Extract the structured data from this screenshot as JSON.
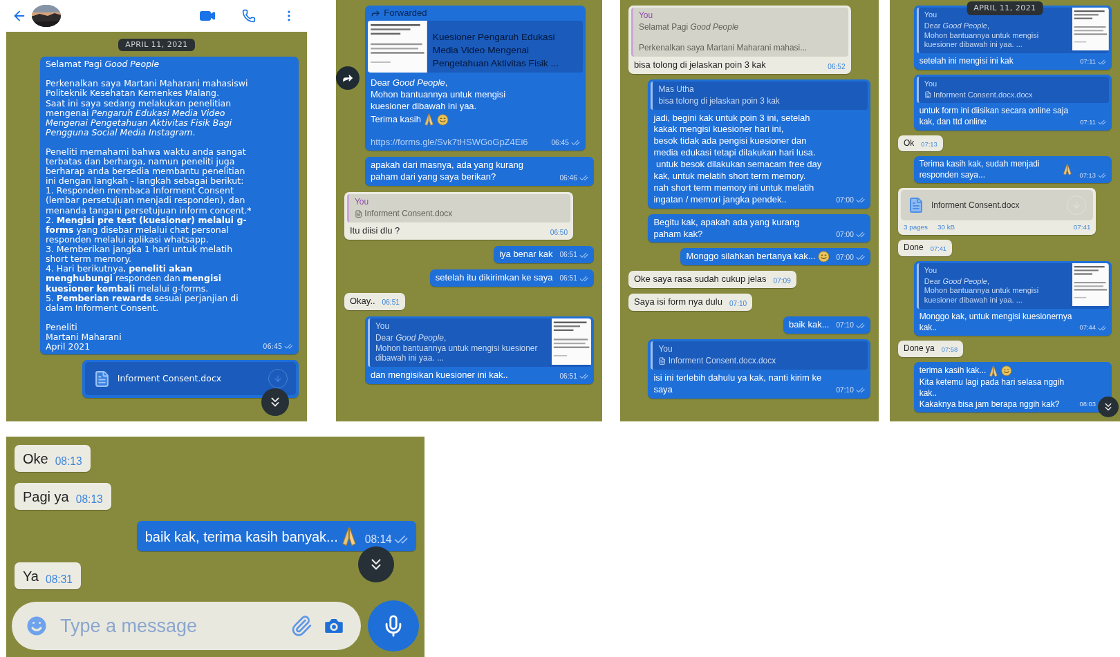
{
  "screens": [
    {
      "header": {
        "avatar": {
          "kind": "picture"
        }
      },
      "scroll_button": true,
      "messages": [
        {
          "kind": "date",
          "text": "APRIL 11, 2021"
        },
        {
          "kind": "text",
          "outgoing": true,
          "paragraphs": [
            [
              "Selamat Pagi *Good People*"
            ],
            [
              "Perkenalkan saya Martani Maharani mahasiswi Politeknik Kesehatan Kemenkes Malang.",
              "Saat ini saya sedang melakukan penelitian mengenai *Pengaruh Edukasi Media Video Mengenai Pengetahuan Aktivitas Fisik Bagi Pengguna Social Media Instagram*."
            ],
            [
              "Peneliti memahami bahwa waktu anda sangat terbatas dan berharga, namun peneliti juga berharap anda bersedia membantu penelitian ini dengan langkah - langkah sebagai berikut:",
              "1. Responden membaca Informent Consent (lembar persetujuan menjadi responden), dan menanda tangani persetujuan inform concent.*",
              "2. **Mengisi pre test (kuesioner) melalui g-forms** yang disebar melalui chat personal responden melalui aplikasi whatsapp.",
              "3. Memberikan jangka 1 hari untuk melatih short term memory.",
              "4. Hari berikutnya, **peneliti akan menghubungi** responden dan **mengisi kuesioner kembali** melalui g-forms.",
              "5. **Pemberian rewards** sesuai perjanjian di dalam Informent Consent."
            ],
            [
              "Peneliti",
              "Martani Maharani",
              "April 2021"
            ]
          ],
          "time": "06:45"
        },
        {
          "kind": "document",
          "outgoing": true,
          "file": "Informent Consent.docx"
        }
      ]
    },
    {
      "messages": [
        {
          "kind": "text",
          "outgoing": true,
          "forwarded": "Forwarded",
          "forward_button": true,
          "preview": {
            "thumbnail": true,
            "title": "Kuesioner Pengaruh Edukasi Media Video Mengenai Pengetahuan Aktivitas Fisik ..."
          },
          "lines": [
            {
              "text": "Dear *Good People*,"
            },
            {
              "text": "Mohon bantuannya untuk mengisi kuesioner dibawah ini yaa."
            },
            {
              "text": "Terima kasih",
              "emoji": [
                {
                  "kind": "pray"
                },
                {
                  "kind": "smile"
                }
              ]
            }
          ],
          "link": "https://forms.gle/Svk7tHSWGoGpZ4Ei6",
          "time": "06:45"
        },
        {
          "kind": "text",
          "outgoing": true,
          "lines": [
            {
              "text": "apakah dari masnya, ada yang kurang paham dari yang saya berikan?"
            }
          ],
          "time": "06:46"
        },
        {
          "kind": "text",
          "outgoing": false,
          "quote": {
            "author": "You",
            "text": "Informent Consent.docx",
            "doc": true
          },
          "lines": [
            {
              "text": "Itu diisi dlu ?"
            }
          ],
          "time": "06:50"
        },
        {
          "kind": "text",
          "outgoing": true,
          "lines": [
            {
              "text": "iya benar kak"
            }
          ],
          "time": "06:51"
        },
        {
          "kind": "text",
          "outgoing": true,
          "lines": [
            {
              "text": "setelah itu dikirimkan ke saya"
            }
          ],
          "time": "06:51"
        },
        {
          "kind": "text",
          "outgoing": false,
          "lines": [
            {
              "text": "Okay.."
            }
          ],
          "time": "06:51"
        },
        {
          "kind": "text",
          "outgoing": true,
          "quote": {
            "author": "You",
            "text": "Dear *Good People*,\nMohon bantuannya untuk mengisi kuesioner dibawah ini yaa. ...",
            "thumbnail": true
          },
          "lines": [
            {
              "text": "dan mengisikan kuesioner ini kak.."
            }
          ],
          "time": "06:51"
        }
      ]
    },
    {
      "messages": [
        {
          "kind": "text",
          "outgoing": false,
          "quote": {
            "author": "You",
            "text": "Selamat Pagi *Good People*\n\nPerkenalkan saya Martani Maharani mahasi..."
          },
          "lines": [
            {
              "text": "bisa tolong di jelaskan poin 3 kak"
            }
          ],
          "time": "06:52"
        },
        {
          "kind": "text",
          "outgoing": true,
          "quote": {
            "author": "Mas Utha",
            "text": "bisa tolong di jelaskan poin 3 kak"
          },
          "lines": [
            {
              "text": "jadi, begini kak untuk poin 3 ini, setelah kakak mengisi kuesioner hari ini,"
            },
            {
              "text": "besok tidak ada pengisi kuesioner dan media edukasi tetapi dilakukan hari lusa."
            },
            {
              "text": " untuk besok dilakukan semacam free day kak, untuk melatih short term memory."
            },
            {
              "text": "nah short term memory ini untuk melatih ingatan / memori jangka pendek.."
            }
          ],
          "time": "07:00"
        },
        {
          "kind": "text",
          "outgoing": true,
          "lines": [
            {
              "text": "Begitu kak, apakah ada yang kurang paham kak?"
            }
          ],
          "time": "07:00"
        },
        {
          "kind": "text",
          "outgoing": true,
          "lines": [
            {
              "text": "Monggo silahkan bertanya kak...",
              "emoji": [
                {
                  "kind": "smile"
                }
              ]
            }
          ],
          "time": "07:00"
        },
        {
          "kind": "text",
          "outgoing": false,
          "lines": [
            {
              "text": "Oke saya rasa sudah cukup jelas"
            }
          ],
          "time": "07:09"
        },
        {
          "kind": "text",
          "outgoing": false,
          "lines": [
            {
              "text": "Saya isi form nya dulu"
            }
          ],
          "time": "07:10"
        },
        {
          "kind": "text",
          "outgoing": true,
          "lines": [
            {
              "text": "baik kak..."
            }
          ],
          "time": "07:10"
        },
        {
          "kind": "text",
          "outgoing": true,
          "quote": {
            "author": "You",
            "text": "Informent Consent.docx.docx",
            "doc": true
          },
          "lines": [
            {
              "text": "isi ini terlebih dahulu ya kak, nanti kirim ke saya"
            }
          ],
          "time": "07:10"
        }
      ]
    },
    {
      "floating_date": "APRIL 11, 2021",
      "scroll_button": true,
      "messages": [
        {
          "kind": "text",
          "outgoing": true,
          "quote": {
            "author": "You",
            "text": "Dear *Good People*,\nMohon bantuannya untuk mengisi kuesioner dibawah ini yaa. ...",
            "thumbnail": true
          },
          "lines": [
            {
              "text": "setelah ini mengisi ini kak"
            }
          ],
          "time": "07:11"
        },
        {
          "kind": "text",
          "outgoing": true,
          "quote": {
            "author": "You",
            "text": "Informent Consent.docx.docx",
            "doc": true
          },
          "lines": [
            {
              "text": "untuk form ini diisikan secara online saja kak, dan ttd online"
            }
          ],
          "time": "07:11"
        },
        {
          "kind": "text",
          "outgoing": false,
          "lines": [
            {
              "text": "Ok"
            }
          ],
          "time": "07:13"
        },
        {
          "kind": "text",
          "outgoing": true,
          "lines": [
            {
              "text": "Terima kasih kak, sudah menjadi responden saya...",
              "emoji": [
                {
                  "kind": "pray"
                }
              ]
            }
          ],
          "time": "07:13"
        },
        {
          "kind": "document",
          "outgoing": false,
          "file": "Informent Consent.docx",
          "pages": "3 pages",
          "size": "30 kB",
          "time": "07:41"
        },
        {
          "kind": "text",
          "outgoing": false,
          "lines": [
            {
              "text": "Done"
            }
          ],
          "time": "07:41"
        },
        {
          "kind": "text",
          "outgoing": true,
          "quote": {
            "author": "You",
            "text": "Dear *Good People*,\nMohon bantuannya untuk mengisi kuesioner dibawah ini yaa. ...",
            "thumbnail": true
          },
          "lines": [
            {
              "text": "Monggo kak, untuk mengisi kuesionernya kak.."
            }
          ],
          "time": "07:44"
        },
        {
          "kind": "text",
          "outgoing": false,
          "lines": [
            {
              "text": "Done ya"
            }
          ],
          "time": "07:58"
        },
        {
          "kind": "text",
          "outgoing": true,
          "lines": [
            {
              "text": "terima kasih kak...",
              "emoji": [
                {
                  "kind": "pray"
                },
                {
                  "kind": "smile"
                }
              ]
            },
            {
              "text": "Kita ketemu lagi pada hari selasa nggih kak.."
            },
            {
              "text": "Kakaknya bisa jam berapa nggih kak?"
            }
          ],
          "time": "08:03"
        }
      ]
    }
  ],
  "last_screen": {
    "scroll_button": true,
    "messages": [
      {
        "kind": "text",
        "outgoing": false,
        "lines": [
          {
            "text": "Oke"
          }
        ],
        "time": "08:13"
      },
      {
        "kind": "text",
        "outgoing": false,
        "lines": [
          {
            "text": "Pagi ya"
          }
        ],
        "time": "08:13"
      },
      {
        "kind": "text",
        "outgoing": true,
        "lines": [
          {
            "text": "baik kak, terima kasih banyak...",
            "emoji": [
              {
                "kind": "pray"
              }
            ]
          }
        ],
        "time": "08:14"
      },
      {
        "kind": "text",
        "outgoing": false,
        "lines": [
          {
            "text": "Ya"
          }
        ],
        "time": "08:31"
      }
    ],
    "composer": {
      "placeholder": "Type a message"
    }
  }
}
